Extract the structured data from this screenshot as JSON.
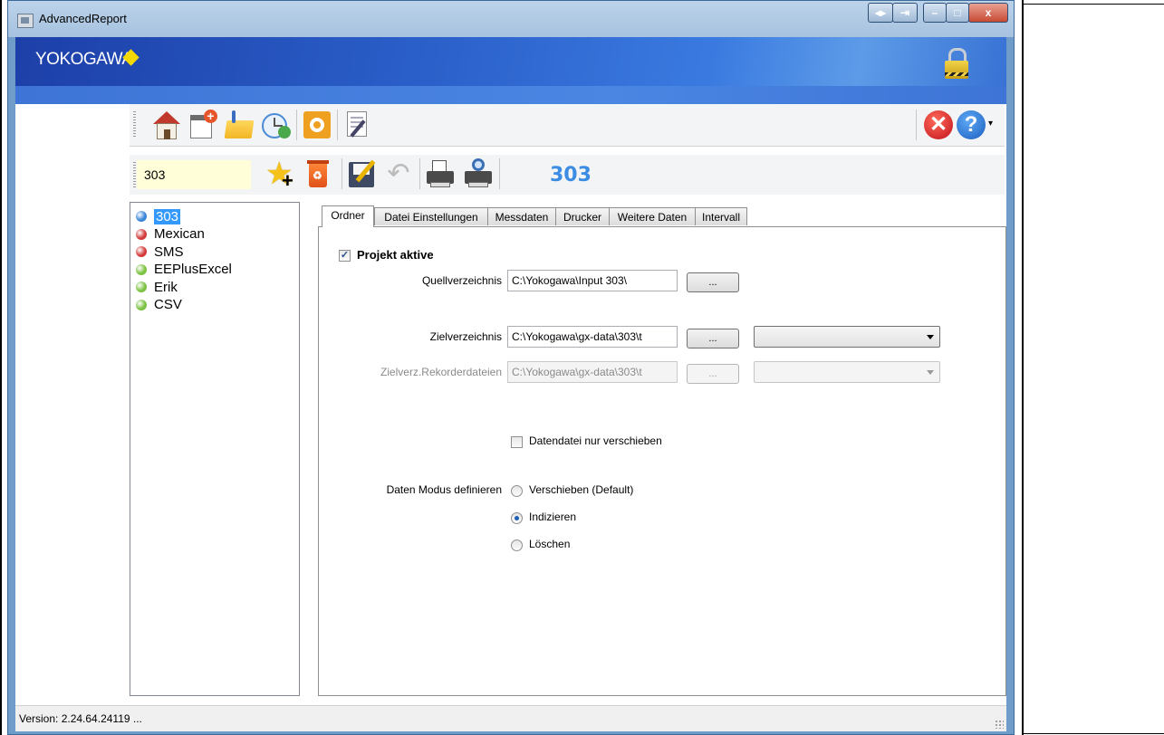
{
  "window": {
    "title": "AdvancedReport",
    "controls": [
      "◂▸",
      "⇥",
      "–",
      "□",
      "x"
    ]
  },
  "banner": {
    "logo": "YOKOGAWA"
  },
  "toolbar": {
    "project_name_value": "303",
    "project_title": "303"
  },
  "projects": [
    {
      "name": "303",
      "status_color": "#3a86d8",
      "selected": true
    },
    {
      "name": "Mexican",
      "status_color": "#d33b3b",
      "selected": false
    },
    {
      "name": "SMS",
      "status_color": "#d33b3b",
      "selected": false
    },
    {
      "name": "EEPlusExcel",
      "status_color": "#7cc242",
      "selected": false
    },
    {
      "name": "Erik",
      "status_color": "#7cc242",
      "selected": false
    },
    {
      "name": "CSV",
      "status_color": "#7cc242",
      "selected": false
    }
  ],
  "tabs": [
    "Ordner",
    "Datei Einstellungen",
    "Messdaten",
    "Drucker",
    "Weitere Daten",
    "Intervall"
  ],
  "ordner": {
    "projekt_aktive_label": "Projekt aktive",
    "projekt_aktive_checked": true,
    "quellverzeichnis_label": "Quellverzeichnis",
    "quellverzeichnis_value": "C:\\Yokogawa\\Input 303\\",
    "zielverzeichnis_label": "Zielverzeichnis",
    "zielverzeichnis_value": "C:\\Yokogawa\\gx-data\\303\\t",
    "zielverz_rekorder_label": "Zielverz.Rekorderdateien",
    "zielverz_rekorder_value": "C:\\Yokogawa\\gx-data\\303\\t",
    "browse_label": "...",
    "datendatei_label": "Datendatei nur verschieben",
    "datendatei_checked": false,
    "modus_label": "Daten Modus definieren",
    "modus_options": [
      "Verschieben (Default)",
      "Indizieren",
      "Löschen"
    ],
    "modus_selected": "Indizieren"
  },
  "status": {
    "version": "Version: 2.24.64.24119 ..."
  }
}
